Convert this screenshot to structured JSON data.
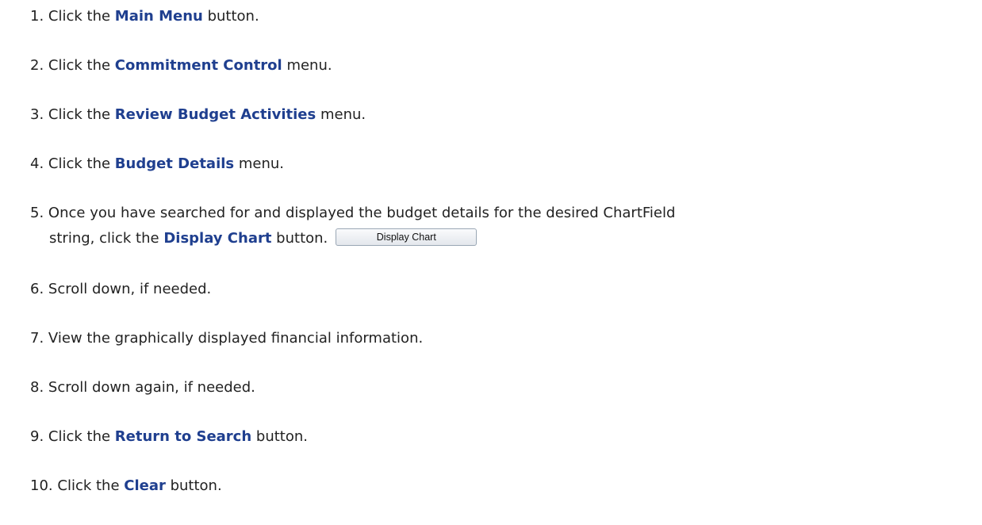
{
  "steps": [
    {
      "num": "1.",
      "pre": "Click the ",
      "kw": "Main Menu",
      "post": " button."
    },
    {
      "num": "2.",
      "pre": "Click the ",
      "kw": "Commitment Control",
      "post": " menu."
    },
    {
      "num": "3.",
      "pre": "Click the ",
      "kw": "Review Budget Activities",
      "post": " menu."
    },
    {
      "num": "4.",
      "pre": "Click the ",
      "kw": "Budget Details",
      "post": " menu."
    },
    {
      "num": "5.",
      "line1": "Once you have searched for and displayed the budget details for the desired ChartField",
      "pre": "string, click the ",
      "kw": "Display Chart",
      "post": " button.",
      "button_label": "Display Chart"
    },
    {
      "num": "6.",
      "text": "Scroll down, if needed."
    },
    {
      "num": "7.",
      "text": "View the graphically displayed financial information."
    },
    {
      "num": "8.",
      "text": "Scroll down again, if needed."
    },
    {
      "num": "9.",
      "pre": "Click the ",
      "kw": "Return to Search",
      "post": " button."
    },
    {
      "num": "10.",
      "pre": "Click the ",
      "kw": "Clear",
      "post": " button."
    }
  ]
}
